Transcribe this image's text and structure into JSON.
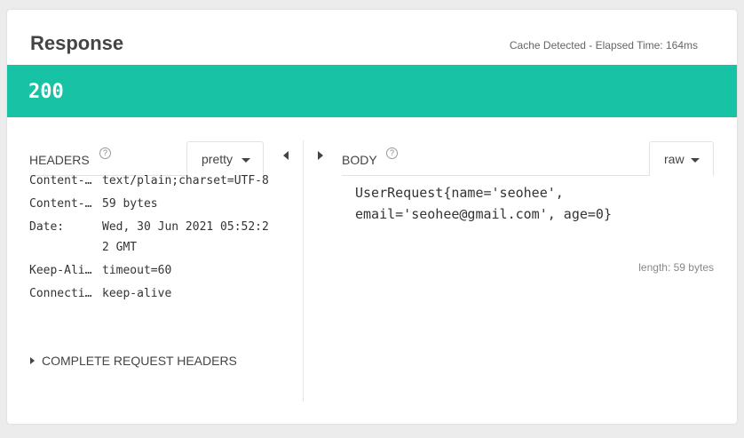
{
  "response": {
    "title": "Response",
    "elapsed": "Cache Detected - Elapsed Time: 164ms",
    "status_code": "200",
    "status_color": "#18c3a5"
  },
  "headers_panel": {
    "title": "HEADERS",
    "help_icon": "?",
    "format": "pretty",
    "rows": [
      {
        "key": "Content-…",
        "value": "text/plain;charset=UTF-8"
      },
      {
        "key": "Content-…",
        "value": "59 bytes"
      },
      {
        "key": "Date:",
        "value": "Wed, 30 Jun 2021 05:52:22 GMT"
      },
      {
        "key": "Keep-Ali…",
        "value": "timeout=60"
      },
      {
        "key": "Connecti…",
        "value": "keep-alive"
      }
    ],
    "complete_link": "COMPLETE REQUEST HEADERS"
  },
  "body_panel": {
    "title": "BODY",
    "help_icon": "?",
    "format": "raw",
    "content": "UserRequest{name='seohee', email='seohee@gmail.com', age=0}",
    "length": "length: 59 bytes"
  }
}
